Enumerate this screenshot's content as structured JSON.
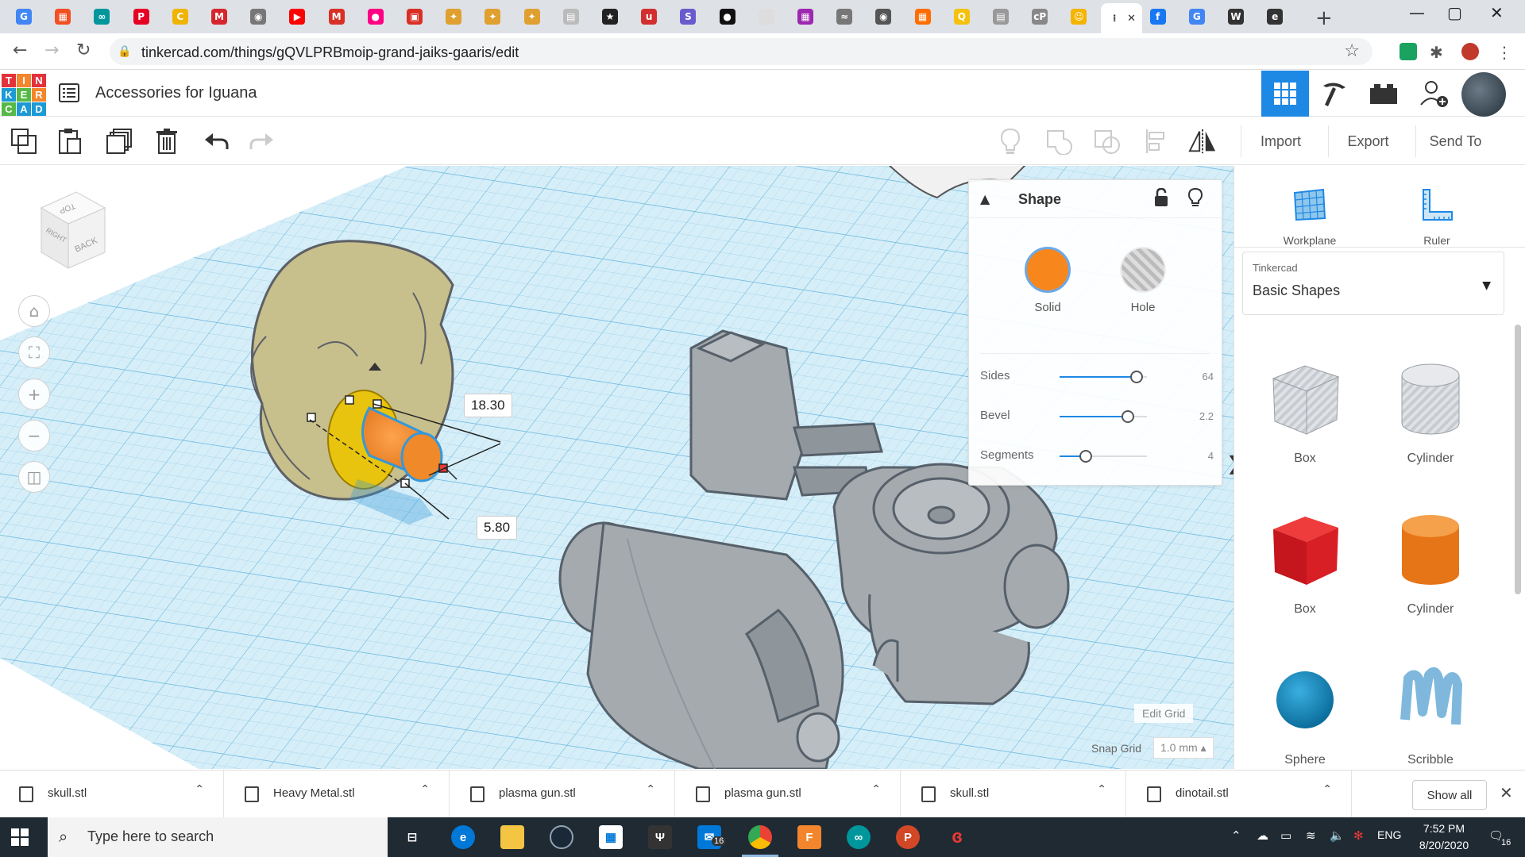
{
  "browser": {
    "tabs": [
      {
        "icon": "google-translate-icon",
        "color": "#4285f4",
        "glyph": "G"
      },
      {
        "icon": "microsoft-icon",
        "color": "#f25022",
        "glyph": "▦"
      },
      {
        "icon": "arduino-icon",
        "color": "#00979c",
        "glyph": "∞"
      },
      {
        "icon": "pinterest-icon",
        "color": "#e60023",
        "glyph": "P"
      },
      {
        "icon": "c-icon",
        "color": "#f0b400",
        "glyph": "C"
      },
      {
        "icon": "m-icon",
        "color": "#d6262d",
        "glyph": "M"
      },
      {
        "icon": "globe-icon",
        "color": "#777777",
        "glyph": "◉"
      },
      {
        "icon": "youtube-icon",
        "color": "#ff0000",
        "glyph": "▶"
      },
      {
        "icon": "gmail-icon",
        "color": "#d93025",
        "glyph": "M"
      },
      {
        "icon": "flickr-icon",
        "color": "#ff0084",
        "glyph": "●"
      },
      {
        "icon": "pdf-icon",
        "color": "#d93025",
        "glyph": "▣"
      },
      {
        "icon": "bulb-icon",
        "color": "#e0a030",
        "glyph": "✦"
      },
      {
        "icon": "bulb-icon",
        "color": "#e0a030",
        "glyph": "✦"
      },
      {
        "icon": "bulb-icon",
        "color": "#e0a030",
        "glyph": "✦"
      },
      {
        "icon": "page-icon",
        "color": "#bbbbbb",
        "glyph": "▤"
      },
      {
        "icon": "star-icon",
        "color": "#222222",
        "glyph": "★"
      },
      {
        "icon": "u-icon",
        "color": "#d32f2f",
        "glyph": "u"
      },
      {
        "icon": "s-icon",
        "color": "#6a5acd",
        "glyph": "S"
      },
      {
        "icon": "circle-icon",
        "color": "#111111",
        "glyph": "●"
      },
      {
        "icon": "blank-icon",
        "color": "#dddddd",
        "glyph": ""
      },
      {
        "icon": "calendar-icon",
        "color": "#9c27b0",
        "glyph": "▦"
      },
      {
        "icon": "feather-icon",
        "color": "#777777",
        "glyph": "≈"
      },
      {
        "icon": "globe-icon",
        "color": "#555555",
        "glyph": "◉"
      },
      {
        "icon": "grid-icon",
        "color": "#ff6d00",
        "glyph": "▦"
      },
      {
        "icon": "q-icon",
        "color": "#f4c20d",
        "glyph": "Q"
      },
      {
        "icon": "page-icon",
        "color": "#999999",
        "glyph": "▤"
      },
      {
        "icon": "cp-icon",
        "color": "#888888",
        "glyph": "cP"
      },
      {
        "icon": "face-icon",
        "color": "#f4b400",
        "glyph": "☺"
      },
      {
        "icon": "tinkercad-tab-icon",
        "color": "#333333",
        "glyph": "⁞",
        "active": true
      },
      {
        "icon": "facebook-icon",
        "color": "#1877f2",
        "glyph": "f"
      },
      {
        "icon": "google-icon",
        "color": "#4285f4",
        "glyph": "G"
      },
      {
        "icon": "wikipedia-icon",
        "color": "#333333",
        "glyph": "W"
      },
      {
        "icon": "edge-icon",
        "color": "#333333",
        "glyph": "e"
      }
    ],
    "new_tab": "+",
    "url": "tinkercad.com/things/gQVLPRBmoip-grand-jaiks-gaaris/edit"
  },
  "app": {
    "logo_letters": [
      {
        "ch": "T",
        "color": "#e3323b"
      },
      {
        "ch": "I",
        "color": "#f3862c"
      },
      {
        "ch": "N",
        "color": "#e3323b"
      },
      {
        "ch": "K",
        "color": "#1c9ad6"
      },
      {
        "ch": "E",
        "color": "#56b947"
      },
      {
        "ch": "R",
        "color": "#f3862c"
      },
      {
        "ch": "C",
        "color": "#56b947"
      },
      {
        "ch": "A",
        "color": "#1c9ad6"
      },
      {
        "ch": "D",
        "color": "#1c9ad6"
      }
    ],
    "design_title": "Accessories for Iguana",
    "accent": "#1e88e5"
  },
  "toolbar": {
    "import_label": "Import",
    "export_label": "Export",
    "send_to_label": "Send To"
  },
  "viewport": {
    "view_cube": {
      "top": "TOP",
      "right": "RIGHT",
      "back": "BACK"
    },
    "dimension_1": "18.30",
    "dimension_2": "5.80",
    "edit_grid_label": "Edit Grid",
    "snap_grid_label": "Snap Grid",
    "snap_grid_value": "1.0 mm ▴"
  },
  "shape_panel": {
    "title": "Shape",
    "solid_label": "Solid",
    "hole_label": "Hole",
    "solid_color": "#f7861c",
    "params": [
      {
        "label": "Sides",
        "value": "64",
        "fraction": 0.88
      },
      {
        "label": "Bevel",
        "value": "2.2",
        "fraction": 0.78
      },
      {
        "label": "Segments",
        "value": "4",
        "fraction": 0.3
      }
    ]
  },
  "right_panel": {
    "workplane_label": "Workplane",
    "ruler_label": "Ruler",
    "library_vendor": "Tinkercad",
    "library_name": "Basic Shapes",
    "shapes": [
      {
        "name": "Box",
        "kind": "box-hole"
      },
      {
        "name": "Cylinder",
        "kind": "cylinder-hole"
      },
      {
        "name": "Box",
        "kind": "box-solid"
      },
      {
        "name": "Cylinder",
        "kind": "cylinder-solid"
      },
      {
        "name": "Sphere",
        "kind": "sphere"
      },
      {
        "name": "Scribble",
        "kind": "scribble"
      }
    ]
  },
  "downloads": {
    "items": [
      "skull.stl",
      "Heavy Metal.stl",
      "plasma gun.stl",
      "plasma gun.stl",
      "skull.stl",
      "dinotail.stl"
    ],
    "show_all_label": "Show all"
  },
  "taskbar": {
    "search_placeholder": "Type here to search",
    "mail_badge": "16",
    "language": "ENG",
    "time": "7:52 PM",
    "date": "8/20/2020",
    "notification_count": "16"
  }
}
